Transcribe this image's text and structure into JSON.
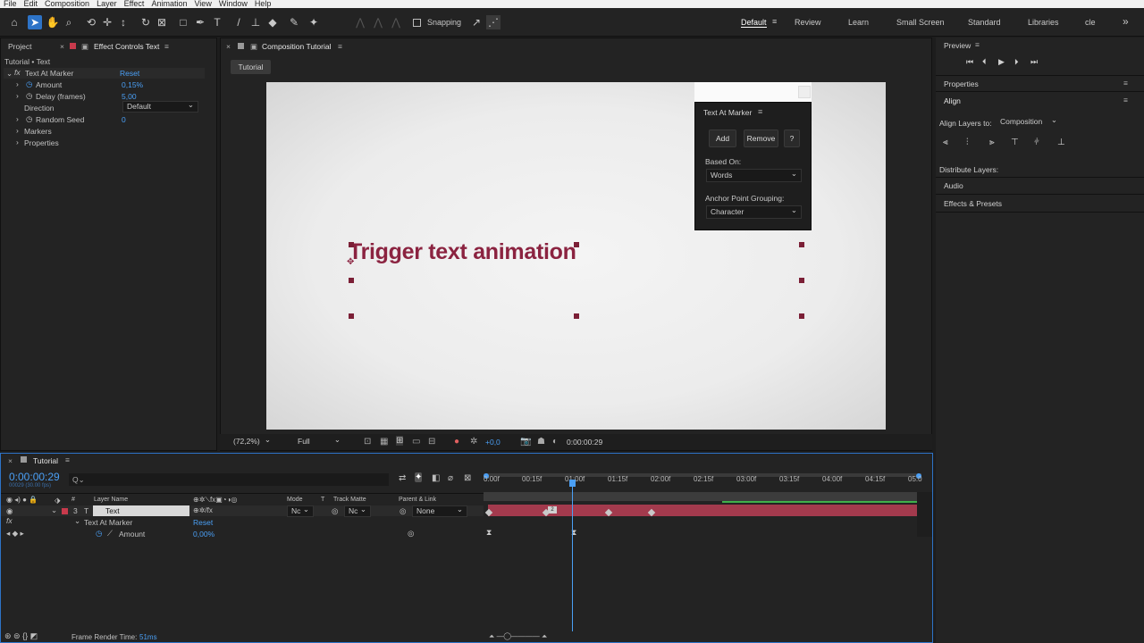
{
  "menu": [
    "File",
    "Edit",
    "Composition",
    "Layer",
    "Effect",
    "Animation",
    "View",
    "Window",
    "Help"
  ],
  "toolbar": {
    "snapping": "Snapping"
  },
  "workspaces": [
    "Default",
    "Review",
    "Learn",
    "Small Screen",
    "Standard",
    "Libraries",
    "cle"
  ],
  "project_tab": "Project",
  "effect_tab": "Effect Controls Text",
  "effect": {
    "breadcrumb": "Tutorial • Text",
    "name": "Text At Marker",
    "reset": "Reset",
    "amount_label": "Amount",
    "amount_value": "0,15%",
    "delay_label": "Delay (frames)",
    "delay_value": "5,00",
    "direction_label": "Direction",
    "direction_value": "Default",
    "seed_label": "Random Seed",
    "seed_value": "0",
    "markers": "Markers",
    "properties": "Properties"
  },
  "comp": {
    "tab": "Composition Tutorial",
    "flow": "Tutorial",
    "zoom": "(72,2%)",
    "res": "Full",
    "exposure": "+0,0",
    "timecode": "0:00:00:29"
  },
  "canvas_text": "Trigger text animation",
  "tam": {
    "title": "Text At Marker",
    "add": "Add",
    "remove": "Remove",
    "help": "?",
    "based_on_label": "Based On:",
    "based_on": "Words",
    "grouping_label": "Anchor Point Grouping:",
    "grouping": "Character"
  },
  "timeline": {
    "tab": "Tutorial",
    "time": "0:00:00:29",
    "fps": "00029 (30.00 fps)",
    "search": "Q⌄",
    "cols": {
      "layer": "Layer Name",
      "mode": "Mode",
      "t": "T",
      "matte": "Track Matte",
      "parent": "Parent & Link"
    },
    "layer_num": "3",
    "layer_type": "T",
    "layer_name": "Text",
    "mode": "Nc",
    "matte": "Nc",
    "parent": "None",
    "fx_name": "Text At Marker",
    "fx_reset": "Reset",
    "amount_label": "Amount",
    "amount_value": "0,00%",
    "ticks": [
      "0:00f",
      "00:15f",
      "01:00f",
      "01:15f",
      "02:00f",
      "02:15f",
      "03:00f",
      "03:15f",
      "04:00f",
      "04:15f",
      "05:0"
    ],
    "render_label": "Frame Render Time:",
    "render_value": "51ms"
  },
  "right": {
    "preview": "Preview",
    "properties": "Properties",
    "align": "Align",
    "align_to_label": "Align Layers to:",
    "align_to": "Composition",
    "distribute": "Distribute Layers:",
    "audio": "Audio",
    "effects": "Effects & Presets"
  },
  "colors": {
    "accent": "#2d73c7",
    "title": "#8b2340",
    "layer_bar": "#a33a4d"
  }
}
